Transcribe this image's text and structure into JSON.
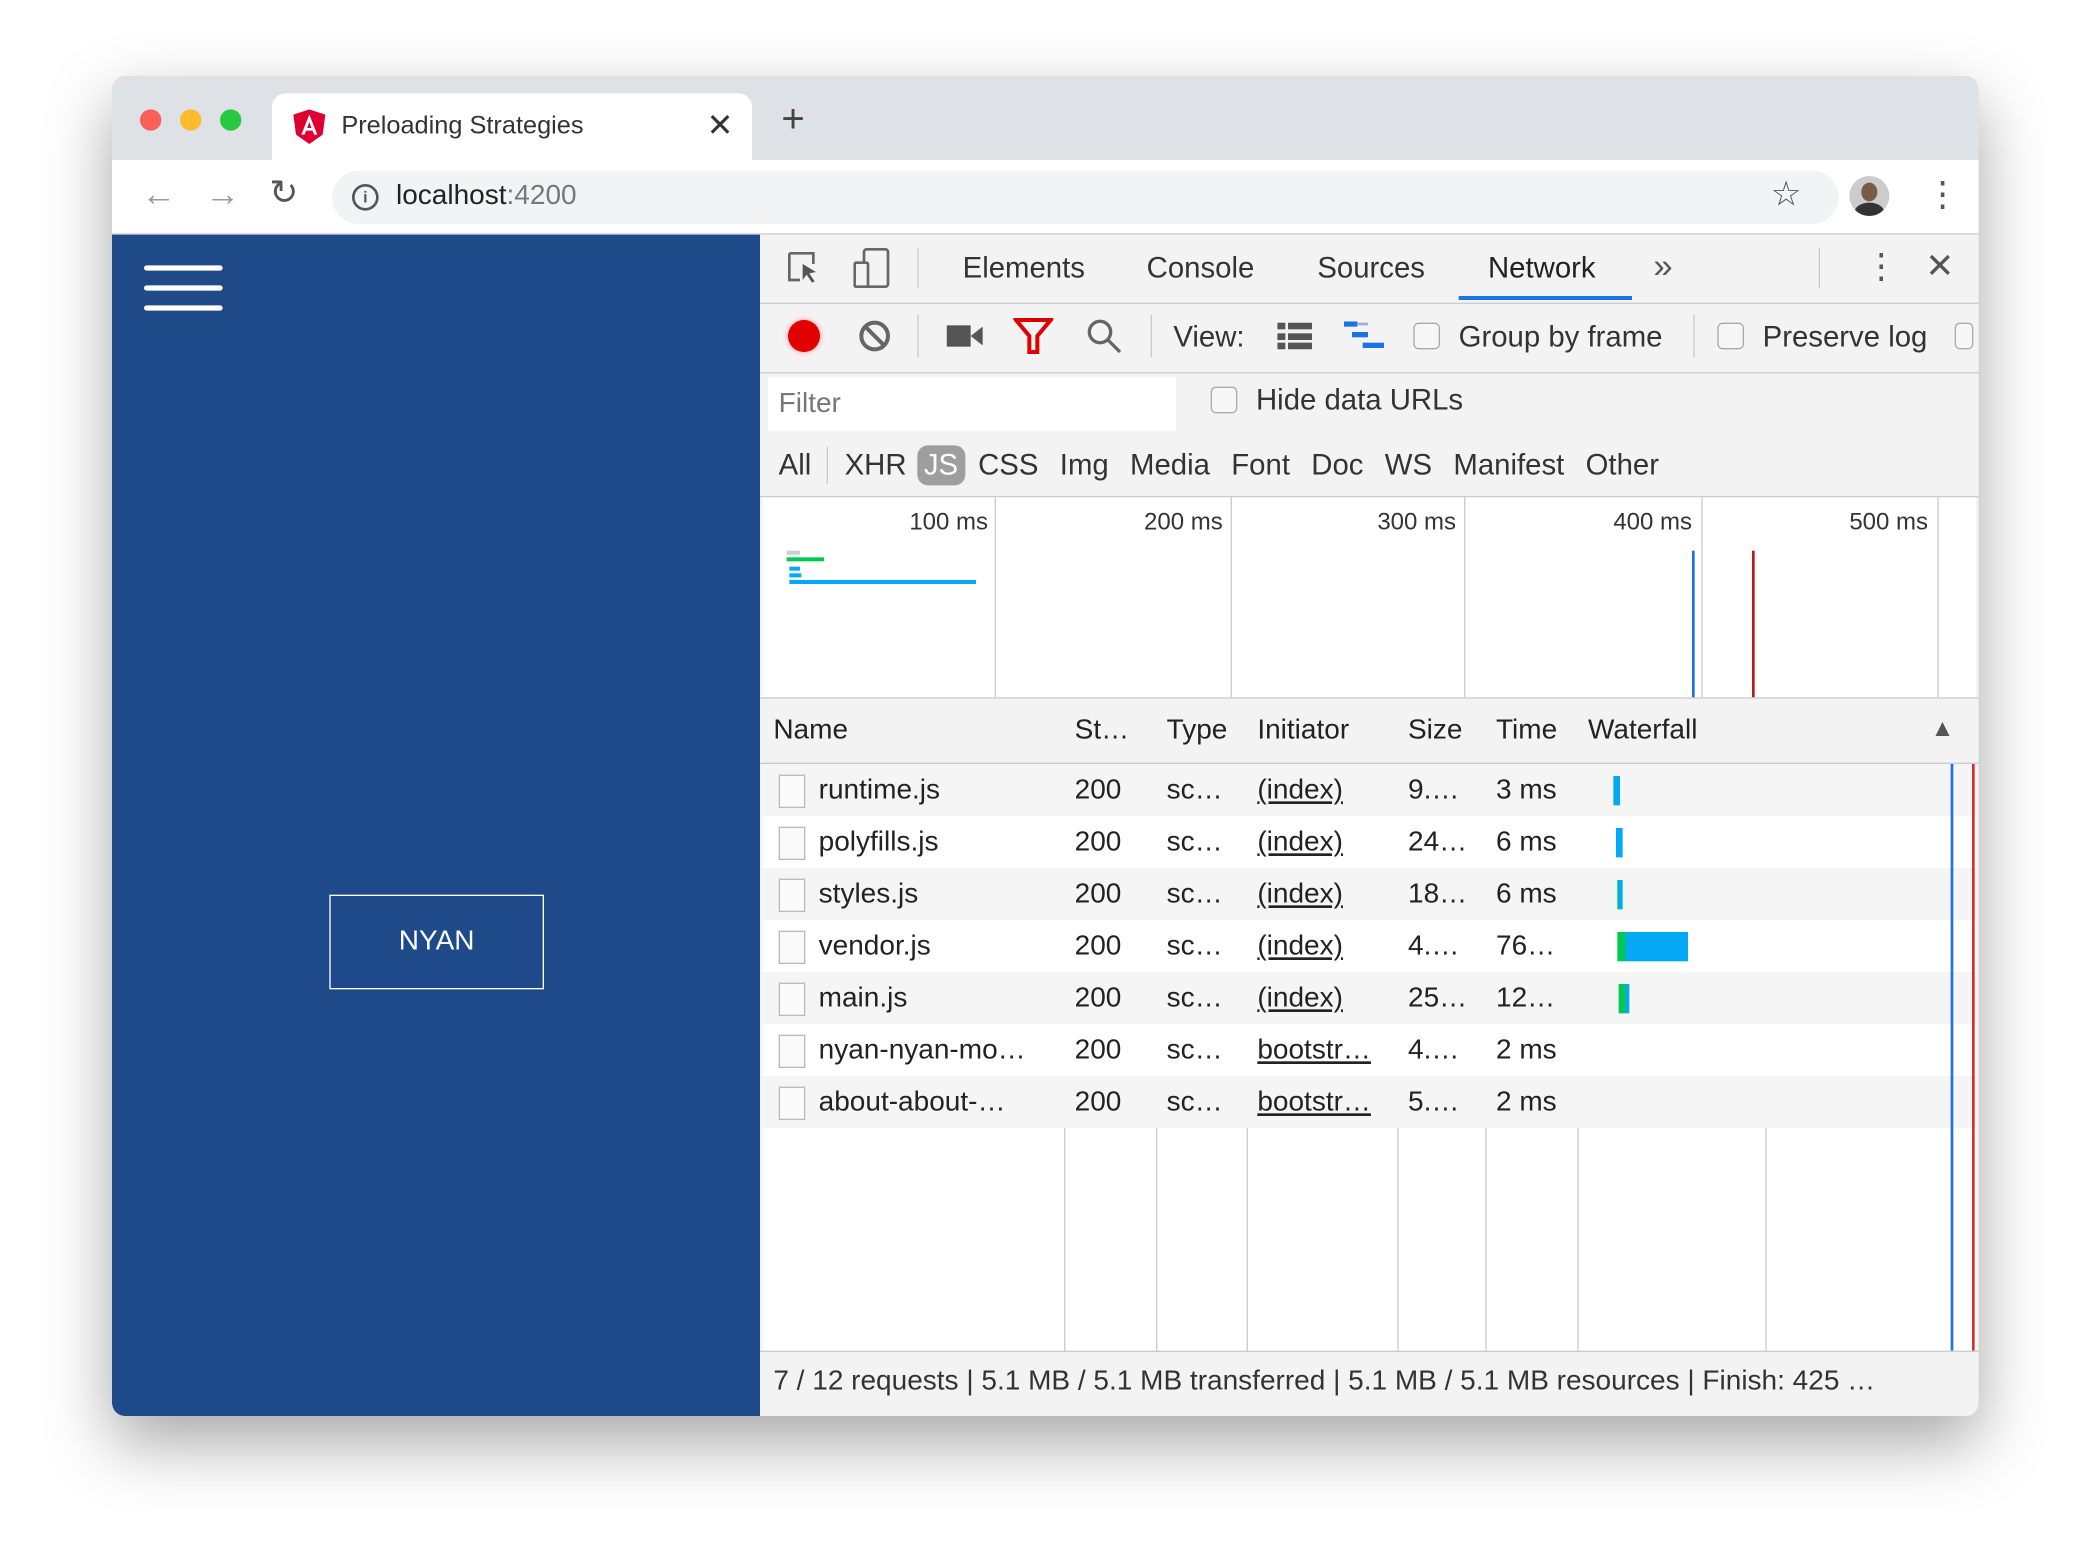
{
  "browser": {
    "tab_title": "Preloading Strategies",
    "url_host": "localhost",
    "url_port": ":4200"
  },
  "page": {
    "button": "NYAN"
  },
  "devtools": {
    "tabs": [
      "Elements",
      "Console",
      "Sources",
      "Network"
    ],
    "active_tab": "Network",
    "toolbar": {
      "view_label": "View:",
      "group_by_frame": "Group by frame",
      "preserve_log": "Preserve log"
    },
    "filter_placeholder": "Filter",
    "hide_data_urls": "Hide data URLs",
    "types": [
      "All",
      "XHR",
      "JS",
      "CSS",
      "Img",
      "Media",
      "Font",
      "Doc",
      "WS",
      "Manifest",
      "Other"
    ],
    "active_type": "JS",
    "overview_ticks": [
      "100 ms",
      "200 ms",
      "300 ms",
      "400 ms",
      "500 ms"
    ],
    "columns": [
      "Name",
      "St…",
      "Type",
      "Initiator",
      "Size",
      "Time",
      "Waterfall"
    ],
    "rows": [
      {
        "name": "runtime.js",
        "status": "200",
        "type": "sc…",
        "initiator": "(index)",
        "size": "9.…",
        "time": "3 ms"
      },
      {
        "name": "polyfills.js",
        "status": "200",
        "type": "sc…",
        "initiator": "(index)",
        "size": "24…",
        "time": "6 ms"
      },
      {
        "name": "styles.js",
        "status": "200",
        "type": "sc…",
        "initiator": "(index)",
        "size": "18…",
        "time": "6 ms"
      },
      {
        "name": "vendor.js",
        "status": "200",
        "type": "sc…",
        "initiator": "(index)",
        "size": "4.…",
        "time": "76…"
      },
      {
        "name": "main.js",
        "status": "200",
        "type": "sc…",
        "initiator": "(index)",
        "size": "25…",
        "time": "12…"
      },
      {
        "name": "nyan-nyan-mo…",
        "status": "200",
        "type": "sc…",
        "initiator": "bootstr…",
        "size": "4.…",
        "time": "2 ms"
      },
      {
        "name": "about-about-…",
        "status": "200",
        "type": "sc…",
        "initiator": "bootstr…",
        "size": "5.…",
        "time": "2 ms"
      }
    ],
    "status_bar": "7 / 12 requests | 5.1 MB / 5.1 MB transferred | 5.1 MB / 5.1 MB resources | Finish: 425 …",
    "colors": {
      "accent": "#1a73e8",
      "record": "#e00000",
      "waiting": "#00c853",
      "download": "#03a9f4",
      "load_line": "#d32f2f"
    }
  }
}
